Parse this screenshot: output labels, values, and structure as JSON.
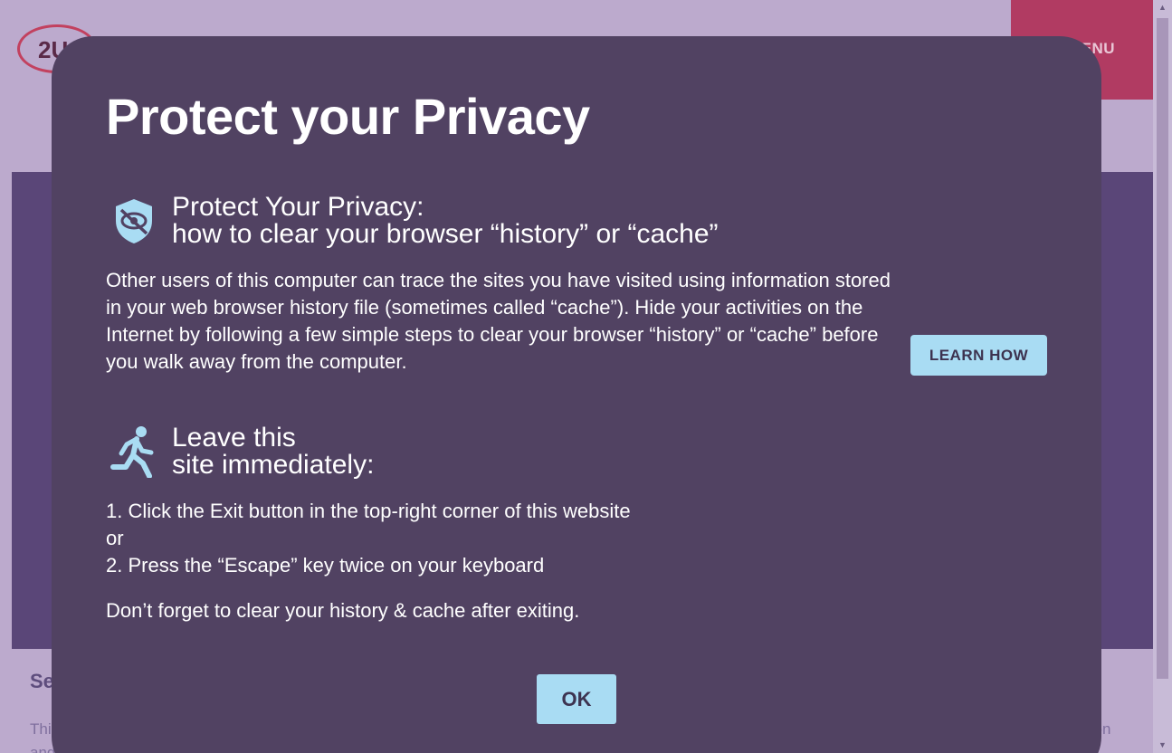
{
  "background": {
    "logo_text": "2U",
    "menu_label": "MENU",
    "card_title": "Se",
    "card_text_start": "Thi",
    "card_text_line2": "and",
    "card_text_end": "tion"
  },
  "modal": {
    "title": "Protect your Privacy",
    "privacy": {
      "icon": "shield-eye-off-icon",
      "heading_line1": "Protect Your Privacy:",
      "heading_line2": "how to clear your browser “history” or “cache”",
      "body": "Other users of this computer can trace the sites you have visited using information stored in your web browser history file (sometimes called “cache”). Hide your activities on the Internet by following a few simple steps to clear your browser “history” or “cache” before you walk away from the computer.",
      "button_label": "LEARN HOW"
    },
    "leave": {
      "icon": "running-person-icon",
      "heading_line1": "Leave this",
      "heading_line2": "site immediately:",
      "step1": "1. Click the Exit button in the top-right corner of this website",
      "or": "or",
      "step2": "2. Press the “Escape” key twice on your keyboard",
      "reminder": "Don’t forget to clear your history & cache after exiting."
    },
    "ok_label": "OK"
  },
  "colors": {
    "overlay_bg": "#bcaacd",
    "modal_bg": "#514262",
    "button_bg": "#a9dcf3",
    "icon_color": "#a9dcf3",
    "menu_bg": "#b13b62"
  }
}
